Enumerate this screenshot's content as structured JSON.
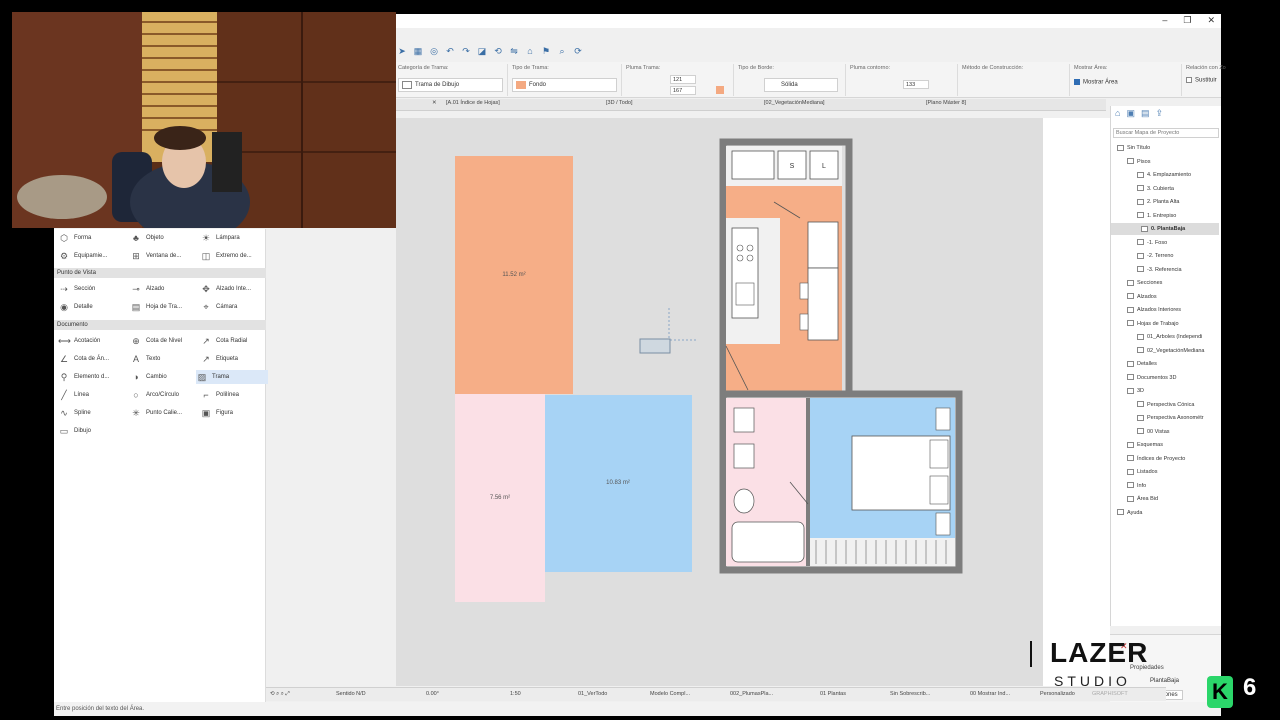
{
  "window": {
    "controls": [
      "–",
      "❐",
      "✕"
    ]
  },
  "infobox": {
    "cat_title": "Categoría de Trama:",
    "cat_value": "Trama de Dibujo",
    "tipo_title": "Tipo de Trama:",
    "tipo_value": "Fondo",
    "pluma_title": "Pluma Trama:",
    "pluma_a": "121",
    "pluma_b": "167",
    "borde_title": "Tipo de Borde:",
    "borde_value": "Sólida",
    "contorno_title": "Pluma contorno:",
    "contorno_value": "133",
    "metodo_title": "Método de Construcción:",
    "area_title": "Mostrar Área:",
    "area_label": "Mostrar Área",
    "rel_title": "Relación con Zo",
    "rel_label": "Sustituir"
  },
  "tabs": [
    "[A.01 Índice de Hojas]",
    "[3D / Todo]",
    "[02_VegetaciónMediana]",
    "[Plano Máster 8]"
  ],
  "toolbox": {
    "rows1": [
      [
        "Forma",
        "Objeto",
        "Lámpara"
      ],
      [
        "Equipamie...",
        "Ventana de...",
        "Extremo de..."
      ]
    ],
    "section_vista": "Punto de Vista",
    "rows2": [
      [
        "Sección",
        "Alzado",
        "Alzado Inte..."
      ],
      [
        "Detalle",
        "Hoja de Tra...",
        "Cámara"
      ]
    ],
    "section_doc": "Documento",
    "rows3": [
      [
        "Acotación",
        "Cota de Nivel",
        "Cota Radial"
      ],
      [
        "Cota de Án...",
        "Texto",
        "Etiqueta"
      ],
      [
        "Elemento d...",
        "Cambio",
        "Trama"
      ],
      [
        "Línea",
        "Arco/Círculo",
        "Polilínea"
      ],
      [
        "Spline",
        "Punto Calie...",
        "Figura"
      ],
      [
        "Dibujo",
        "",
        ""
      ]
    ]
  },
  "canvas": {
    "area_orange": "11.52 m²",
    "area_pink": "7.56 m²",
    "area_blue": "10.83 m²",
    "colors": {
      "orange": "#f6ae87",
      "pink": "#fbe0e6",
      "blue": "#a7d3f5",
      "wall": "#8a8a8a"
    }
  },
  "navigator": {
    "search": "Buscar Mapa de Proyecto",
    "items": [
      {
        "label": "Sin Título",
        "indent": 0
      },
      {
        "label": "Pisos",
        "indent": 1
      },
      {
        "label": "4. Emplazamiento",
        "indent": 2
      },
      {
        "label": "3. Cubierta",
        "indent": 2
      },
      {
        "label": "2. Planta Alta",
        "indent": 2
      },
      {
        "label": "1. Entrepiso",
        "indent": 2
      },
      {
        "label": "0. PlantaBaja",
        "indent": 2,
        "selected": true
      },
      {
        "label": "-1. Foso",
        "indent": 2
      },
      {
        "label": "-2. Terreno",
        "indent": 2
      },
      {
        "label": "-3. Referencia",
        "indent": 2
      },
      {
        "label": "Secciones",
        "indent": 1
      },
      {
        "label": "Alzados",
        "indent": 1
      },
      {
        "label": "Alzados Interiores",
        "indent": 1
      },
      {
        "label": "Hojas de Trabajo",
        "indent": 1
      },
      {
        "label": "01_Arboles (Independi",
        "indent": 2
      },
      {
        "label": "02_VegetaciónMediana",
        "indent": 2
      },
      {
        "label": "Detalles",
        "indent": 1
      },
      {
        "label": "Documentos 3D",
        "indent": 1
      },
      {
        "label": "3D",
        "indent": 1
      },
      {
        "label": "Perspectiva Cónica",
        "indent": 2
      },
      {
        "label": "Perspectiva Axonométr",
        "indent": 2
      },
      {
        "label": "00 Vistas",
        "indent": 2
      },
      {
        "label": "Esquemas",
        "indent": 1
      },
      {
        "label": "Índices de Proyecto",
        "indent": 1
      },
      {
        "label": "Listados",
        "indent": 1
      },
      {
        "label": "Info",
        "indent": 1
      },
      {
        "label": "Área Bid",
        "indent": 1
      },
      {
        "label": "Ayuda",
        "indent": 0
      }
    ],
    "bottom_title": "Propiedades",
    "bottom_value": "PlantaBaja",
    "bottom_btn": "Definiciones"
  },
  "bottombar": {
    "zoom": "0.00°",
    "scale": "1:50",
    "layer": "01_VerTodo",
    "model": "Modelo Compl...",
    "pen": "002_PlumasPla...",
    "floors": "01 Plantas",
    "override": "Sin Sobrescrib...",
    "area": "00 Mostrar Ind...",
    "custom": "Personalizado",
    "graphisoft": "GRAPHISOFT",
    "sin": "Sentido N/D"
  },
  "status": "Entre posición del texto del Área.",
  "watermark": {
    "brand": "LAZER",
    "sub": "STUDIO",
    "badge": "6"
  }
}
